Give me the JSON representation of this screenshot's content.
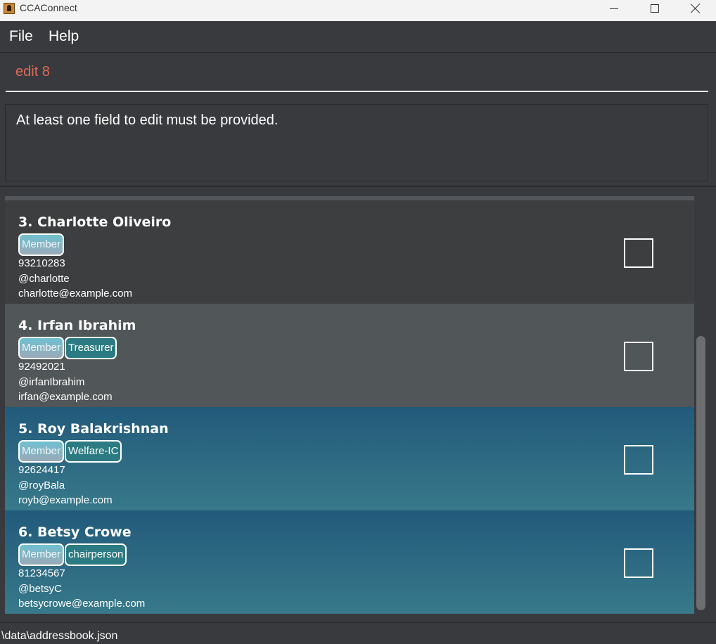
{
  "window": {
    "title": "CCAConnect",
    "controls": [
      "minimize-icon",
      "maximize-icon",
      "close-icon"
    ]
  },
  "menu": {
    "file": "File",
    "help": "Help"
  },
  "command": {
    "value": "edit 8",
    "placeholder": ""
  },
  "result": {
    "message": "At least one field to edit must be provided."
  },
  "persons": [
    {
      "name": "3. Charlotte Oliveiro",
      "tags": [
        "Member"
      ],
      "phone": "93210283",
      "telegram": "@charlotte",
      "email": "charlotte@example.com",
      "checked": false
    },
    {
      "name": "4. Irfan Ibrahim",
      "tags": [
        "Member",
        "Treasurer"
      ],
      "phone": "92492021",
      "telegram": "@irfanIbrahim",
      "email": "irfan@example.com",
      "checked": false
    },
    {
      "name": "5. Roy Balakrishnan",
      "tags": [
        "Member",
        "Welfare-IC"
      ],
      "phone": "92624417",
      "telegram": "@royBala",
      "email": "royb@example.com",
      "checked": false
    },
    {
      "name": "6. Betsy Crowe",
      "tags": [
        "Member",
        "chairperson"
      ],
      "phone": "81234567",
      "telegram": "@betsyC",
      "email": "betsycrowe@example.com",
      "checked": false
    }
  ],
  "status": {
    "file_path": "\\data\\addressbook.json"
  },
  "colors": {
    "command_text": "#e0685a",
    "selected_card_top": "#225a7b",
    "selected_card_bottom": "#38798a",
    "tag_member": "#6fc0d0",
    "tag_role": "#2c7b82"
  }
}
